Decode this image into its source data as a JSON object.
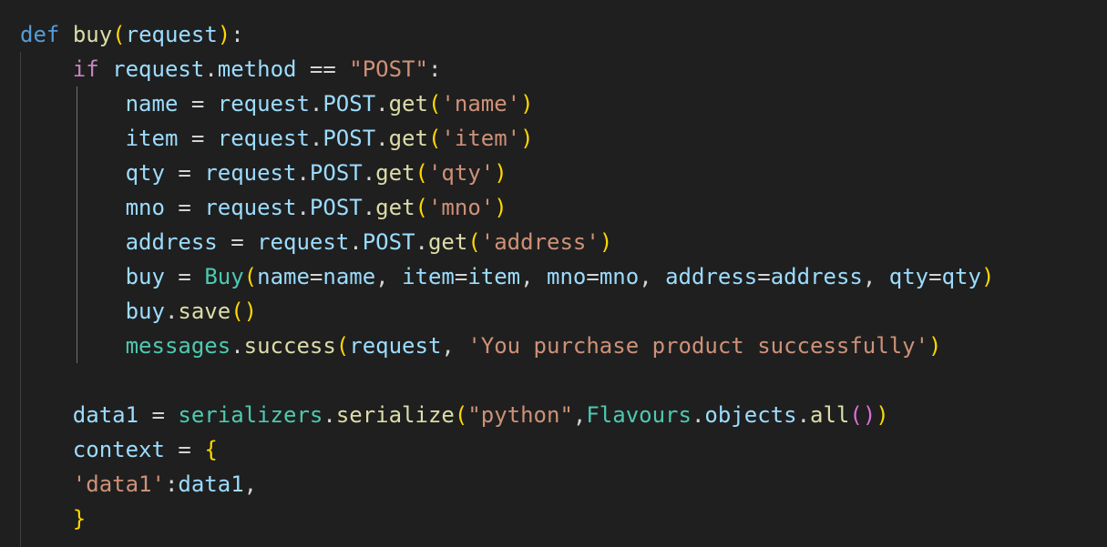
{
  "editor": {
    "language": "python",
    "theme": {
      "background": "#1f1f1f",
      "keyword": "#569cd6",
      "control_keyword": "#c586c0",
      "function": "#dcdcaa",
      "variable": "#9cdcfe",
      "string": "#ce9178",
      "class": "#4ec9b0",
      "bracket_1": "#ffd700",
      "bracket_2": "#da70d6",
      "bracket_3": "#179fff"
    },
    "lines": [
      [
        [
          "kw-def",
          "def"
        ],
        [
          "op",
          " "
        ],
        [
          "fn",
          "buy"
        ],
        [
          "b1",
          "("
        ],
        [
          "var",
          "request"
        ],
        [
          "b1",
          ")"
        ],
        [
          "op",
          ":"
        ]
      ],
      [
        [
          "op",
          "    "
        ],
        [
          "kw-ctl",
          "if"
        ],
        [
          "op",
          " "
        ],
        [
          "var",
          "request"
        ],
        [
          "op",
          "."
        ],
        [
          "var",
          "method"
        ],
        [
          "op",
          " == "
        ],
        [
          "str",
          "\"POST\""
        ],
        [
          "op",
          ":"
        ]
      ],
      [
        [
          "op",
          "        "
        ],
        [
          "var",
          "name"
        ],
        [
          "op",
          " = "
        ],
        [
          "var",
          "request"
        ],
        [
          "op",
          "."
        ],
        [
          "var",
          "POST"
        ],
        [
          "op",
          "."
        ],
        [
          "fn",
          "get"
        ],
        [
          "b1",
          "("
        ],
        [
          "str",
          "'name'"
        ],
        [
          "b1",
          ")"
        ]
      ],
      [
        [
          "op",
          "        "
        ],
        [
          "var",
          "item"
        ],
        [
          "op",
          " = "
        ],
        [
          "var",
          "request"
        ],
        [
          "op",
          "."
        ],
        [
          "var",
          "POST"
        ],
        [
          "op",
          "."
        ],
        [
          "fn",
          "get"
        ],
        [
          "b1",
          "("
        ],
        [
          "str",
          "'item'"
        ],
        [
          "b1",
          ")"
        ]
      ],
      [
        [
          "op",
          "        "
        ],
        [
          "var",
          "qty"
        ],
        [
          "op",
          " = "
        ],
        [
          "var",
          "request"
        ],
        [
          "op",
          "."
        ],
        [
          "var",
          "POST"
        ],
        [
          "op",
          "."
        ],
        [
          "fn",
          "get"
        ],
        [
          "b1",
          "("
        ],
        [
          "str",
          "'qty'"
        ],
        [
          "b1",
          ")"
        ]
      ],
      [
        [
          "op",
          "        "
        ],
        [
          "var",
          "mno"
        ],
        [
          "op",
          " = "
        ],
        [
          "var",
          "request"
        ],
        [
          "op",
          "."
        ],
        [
          "var",
          "POST"
        ],
        [
          "op",
          "."
        ],
        [
          "fn",
          "get"
        ],
        [
          "b1",
          "("
        ],
        [
          "str",
          "'mno'"
        ],
        [
          "b1",
          ")"
        ]
      ],
      [
        [
          "op",
          "        "
        ],
        [
          "var",
          "address"
        ],
        [
          "op",
          " = "
        ],
        [
          "var",
          "request"
        ],
        [
          "op",
          "."
        ],
        [
          "var",
          "POST"
        ],
        [
          "op",
          "."
        ],
        [
          "fn",
          "get"
        ],
        [
          "b1",
          "("
        ],
        [
          "str",
          "'address'"
        ],
        [
          "b1",
          ")"
        ]
      ],
      [
        [
          "op",
          "        "
        ],
        [
          "var",
          "buy"
        ],
        [
          "op",
          " = "
        ],
        [
          "cls",
          "Buy"
        ],
        [
          "b1",
          "("
        ],
        [
          "var",
          "name"
        ],
        [
          "op",
          "="
        ],
        [
          "var",
          "name"
        ],
        [
          "op",
          ", "
        ],
        [
          "var",
          "item"
        ],
        [
          "op",
          "="
        ],
        [
          "var",
          "item"
        ],
        [
          "op",
          ", "
        ],
        [
          "var",
          "mno"
        ],
        [
          "op",
          "="
        ],
        [
          "var",
          "mno"
        ],
        [
          "op",
          ", "
        ],
        [
          "var",
          "address"
        ],
        [
          "op",
          "="
        ],
        [
          "var",
          "address"
        ],
        [
          "op",
          ", "
        ],
        [
          "var",
          "qty"
        ],
        [
          "op",
          "="
        ],
        [
          "var",
          "qty"
        ],
        [
          "b1",
          ")"
        ]
      ],
      [
        [
          "op",
          "        "
        ],
        [
          "var",
          "buy"
        ],
        [
          "op",
          "."
        ],
        [
          "fn",
          "save"
        ],
        [
          "b1",
          "()"
        ]
      ],
      [
        [
          "op",
          "        "
        ],
        [
          "cls",
          "messages"
        ],
        [
          "op",
          "."
        ],
        [
          "fn",
          "success"
        ],
        [
          "b1",
          "("
        ],
        [
          "var",
          "request"
        ],
        [
          "op",
          ", "
        ],
        [
          "str",
          "'You purchase product successfully'"
        ],
        [
          "b1",
          ")"
        ]
      ],
      [],
      [
        [
          "op",
          "    "
        ],
        [
          "var",
          "data1"
        ],
        [
          "op",
          " = "
        ],
        [
          "cls",
          "serializers"
        ],
        [
          "op",
          "."
        ],
        [
          "fn",
          "serialize"
        ],
        [
          "b1",
          "("
        ],
        [
          "str",
          "\"python\""
        ],
        [
          "op",
          ","
        ],
        [
          "cls",
          "Flavours"
        ],
        [
          "op",
          "."
        ],
        [
          "var",
          "objects"
        ],
        [
          "op",
          "."
        ],
        [
          "fn",
          "all"
        ],
        [
          "b2",
          "()"
        ],
        [
          "b1",
          ")"
        ]
      ],
      [
        [
          "op",
          "    "
        ],
        [
          "var",
          "context"
        ],
        [
          "op",
          " = "
        ],
        [
          "b1",
          "{"
        ]
      ],
      [
        [
          "op",
          "    "
        ],
        [
          "str",
          "'data1'"
        ],
        [
          "op",
          ":"
        ],
        [
          "var",
          "data1"
        ],
        [
          "op",
          ","
        ]
      ],
      [
        [
          "op",
          "    "
        ],
        [
          "b1",
          "}"
        ]
      ]
    ]
  }
}
